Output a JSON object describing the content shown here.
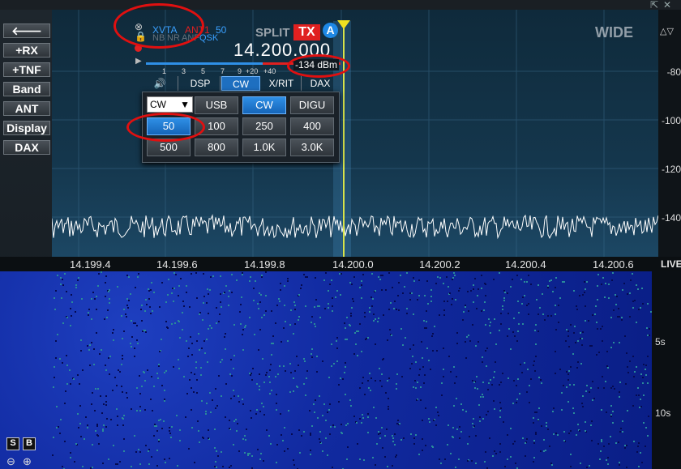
{
  "sidebar": {
    "items": [
      {
        "label": "+RX"
      },
      {
        "label": "+TNF"
      },
      {
        "label": "Band"
      },
      {
        "label": "ANT"
      },
      {
        "label": "Display"
      },
      {
        "label": "DAX"
      }
    ]
  },
  "slice": {
    "xvta": "XVTA",
    "ant": "ANT1",
    "filter_width": "50",
    "nb": "NB",
    "nr": "NR",
    "anf": "ANF",
    "qsk": "QSK",
    "split": "SPLIT",
    "tx": "TX",
    "letter": "A",
    "freq": "14.200.000",
    "signal": "-134 dBm",
    "smeter": [
      "1",
      "3",
      "5",
      "7",
      "9",
      "+20",
      "+40"
    ]
  },
  "tabs": [
    {
      "label": "DSP"
    },
    {
      "label": "CW"
    },
    {
      "label": "X/RIT"
    },
    {
      "label": "DAX"
    }
  ],
  "popup": {
    "mode_select": "CW",
    "modes": [
      "USB",
      "CW",
      "DIGU"
    ],
    "filters": [
      "50",
      "100",
      "250",
      "400",
      "500",
      "800",
      "1.0K",
      "3.0K"
    ]
  },
  "pan": {
    "wide": "WIDE",
    "db_labels": [
      "-80",
      "-100",
      "-120",
      "-140"
    ],
    "freq_labels": [
      "14.199.4",
      "14.199.6",
      "14.199.8",
      "14.200.0",
      "14.200.2",
      "14.200.4",
      "14.200.6"
    ],
    "live": "LIVE",
    "ts_labels": [
      "5s",
      "10s"
    ]
  },
  "bottom": {
    "s": "S",
    "b": "B"
  },
  "colors": {
    "accent": "#1e88e5",
    "tx": "#e02020",
    "cursor": "#d8e34a"
  }
}
